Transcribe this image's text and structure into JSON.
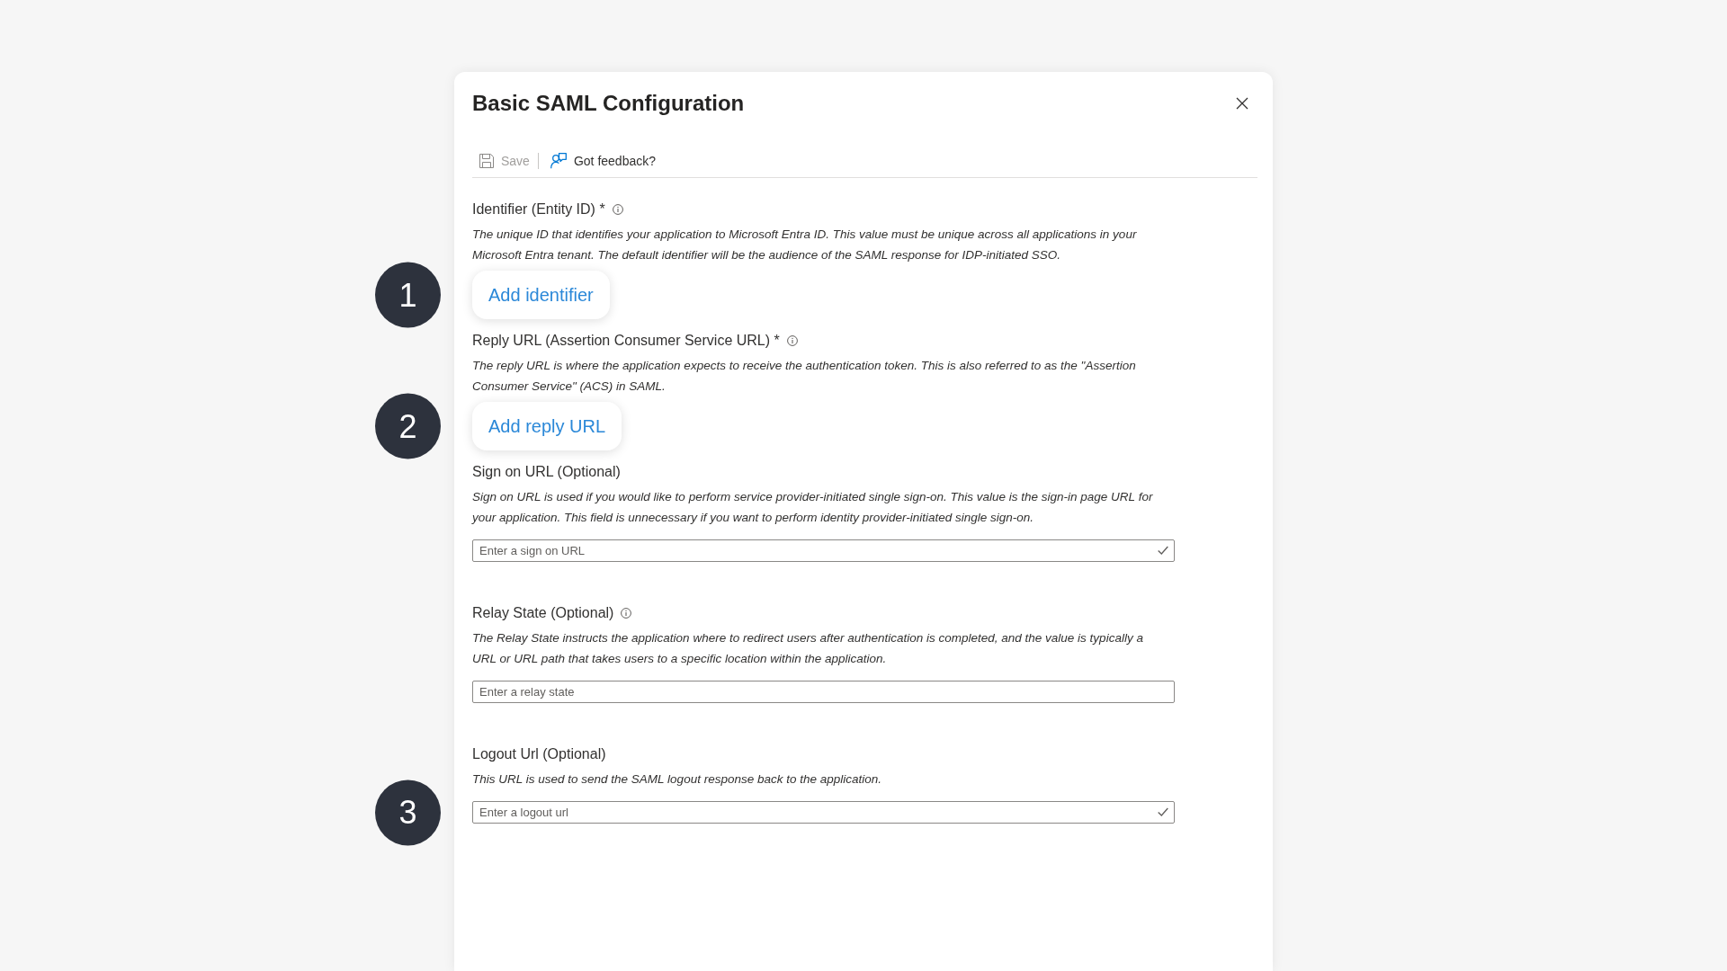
{
  "dialog": {
    "title": "Basic SAML Configuration"
  },
  "toolbar": [
    {
      "kind": "save",
      "label": "Save",
      "disabled": true
    },
    {
      "kind": "feedback",
      "label": "Got feedback?",
      "disabled": false
    }
  ],
  "sections": [
    {
      "label": "Identifier (Entity ID) *",
      "info": true,
      "description": "The unique ID that identifies your application to Microsoft Entra ID. This value must be unique across all applications in your Microsoft Entra tenant. The default identifier will be the audience of the SAML response for IDP-initiated SSO.",
      "control": {
        "kind": "button",
        "label": "Add identifier"
      },
      "step": "1"
    },
    {
      "label": "Reply URL (Assertion Consumer Service URL) *",
      "info": true,
      "description": "The reply URL is where the application expects to receive the authentication token. This is also referred to as the \"Assertion Consumer Service\" (ACS) in SAML.",
      "control": {
        "kind": "button",
        "label": "Add reply URL"
      },
      "step": "2"
    },
    {
      "label": "Sign on URL (Optional)",
      "info": false,
      "description": "Sign on URL is used if you would like to perform service provider-initiated single sign-on. This value is the sign-in page URL for your application. This field is unnecessary if you want to perform identity provider-initiated single sign-on.",
      "control": {
        "kind": "input",
        "placeholder": "Enter a sign on URL",
        "validated": true
      }
    },
    {
      "label": "Relay State (Optional)",
      "info": true,
      "description": "The Relay State instructs the application where to redirect users after authentication is completed, and the value is typically a URL or URL path that takes users to a specific location within the application.",
      "control": {
        "kind": "input",
        "placeholder": "Enter a relay state",
        "validated": false
      }
    },
    {
      "label": "Logout Url (Optional)",
      "info": false,
      "description": "This URL is used to send the SAML logout response back to the application.",
      "control": {
        "kind": "input",
        "placeholder": "Enter a logout url",
        "validated": true
      },
      "step": "3"
    }
  ]
}
